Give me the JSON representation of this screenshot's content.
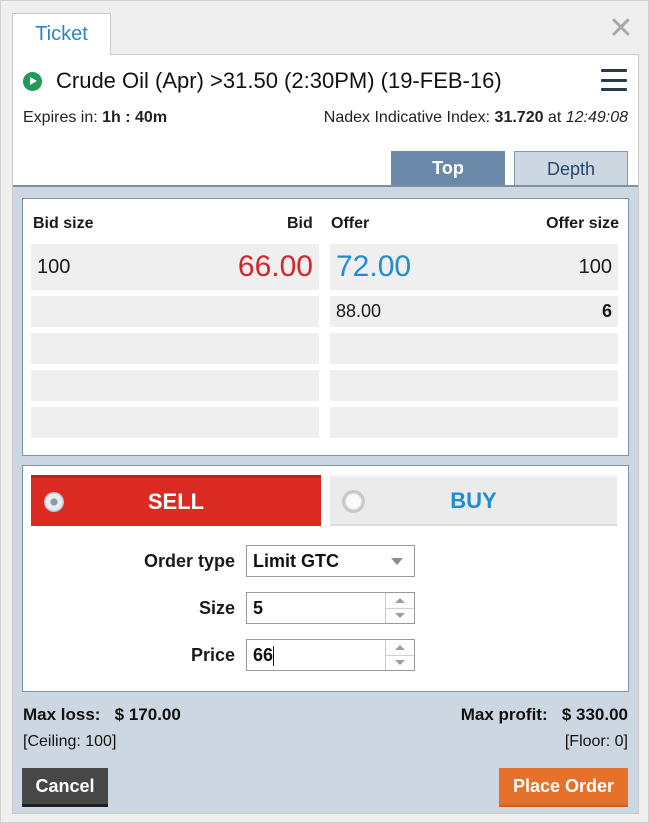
{
  "window": {
    "tab_label": "Ticket",
    "close_icon": "close-icon"
  },
  "header": {
    "status_icon": "play-icon",
    "status_color": "#1f9a57",
    "title": "Crude Oil (Apr) >31.50 (2:30PM) (19-FEB-16)",
    "menu_icon": "hamburger-menu-icon",
    "expires_label": "Expires in: ",
    "expires_value": "1h : 40m",
    "index_label": "Nadex Indicative Index: ",
    "index_value": "31.720",
    "index_at": " at ",
    "index_time": "12:49:08"
  },
  "view_tabs": [
    {
      "label": "Top",
      "active": false
    },
    {
      "label": "Depth",
      "active": true
    }
  ],
  "depth": {
    "headers": {
      "bid_size": "Bid size",
      "bid": "Bid",
      "offer": "Offer",
      "offer_size": "Offer size"
    },
    "rows": [
      {
        "bid_size": "100",
        "bid": "66.00",
        "offer": "72.00",
        "offer_size": "100"
      },
      {
        "bid_size": "",
        "bid": "",
        "offer": "88.00",
        "offer_size": "6"
      },
      {
        "bid_size": "",
        "bid": "",
        "offer": "",
        "offer_size": ""
      },
      {
        "bid_size": "",
        "bid": "",
        "offer": "",
        "offer_size": ""
      },
      {
        "bid_size": "",
        "bid": "",
        "offer": "",
        "offer_size": ""
      }
    ],
    "colors": {
      "bid": "#d3262b",
      "offer": "#1f8ed0"
    }
  },
  "order": {
    "sell_label": "SELL",
    "buy_label": "BUY",
    "selected_side": "SELL",
    "order_type_label": "Order type",
    "order_type_value": "Limit GTC",
    "size_label": "Size",
    "size_value": "5",
    "price_label": "Price",
    "price_value": "66"
  },
  "summary": {
    "max_loss_label": "Max loss:",
    "max_loss_value": "$ 170.00",
    "max_profit_label": "Max profit:",
    "max_profit_value": "$ 330.00",
    "ceiling": "[Ceiling: 100]",
    "floor": "[Floor: 0]"
  },
  "actions": {
    "cancel_label": "Cancel",
    "place_label": "Place Order",
    "place_color": "#e5712a"
  }
}
